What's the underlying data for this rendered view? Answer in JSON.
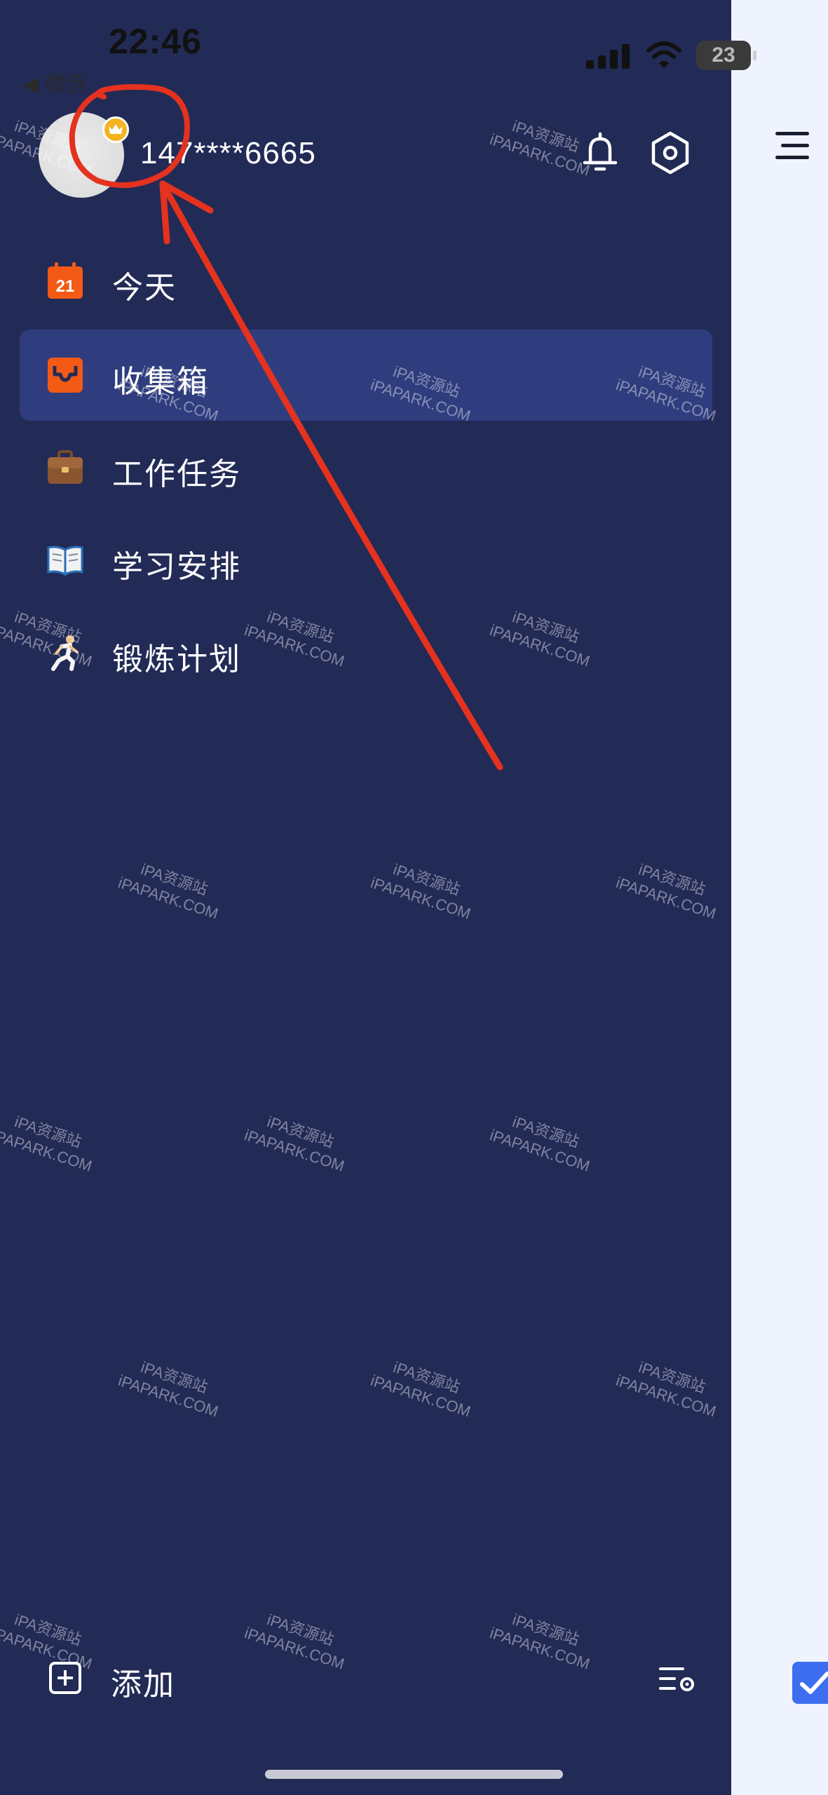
{
  "status_bar": {
    "time": "22:46",
    "back_app": "◀ 微信",
    "battery": "23"
  },
  "profile": {
    "username": "147****6665"
  },
  "menu": {
    "items": [
      {
        "label": "今天",
        "icon": "calendar-icon",
        "badge": "21",
        "active": false
      },
      {
        "label": "收集箱",
        "icon": "inbox-icon",
        "active": true
      },
      {
        "label": "工作任务",
        "icon": "briefcase-icon",
        "active": false
      },
      {
        "label": "学习安排",
        "icon": "book-icon",
        "active": false
      },
      {
        "label": "锻炼计划",
        "icon": "runner-icon",
        "active": false
      }
    ]
  },
  "bottom": {
    "add_label": "添加"
  },
  "watermark": {
    "line1": "iPA资源站",
    "line2": "iPAPARK.COM"
  },
  "colors": {
    "drawer_bg": "#222a56",
    "active_item_bg": "#2f3d7e",
    "accent_orange": "#f25a15",
    "crown_gold": "#f3b322",
    "annotation_red": "#e4321f",
    "fab_blue": "#3d6ef0"
  }
}
